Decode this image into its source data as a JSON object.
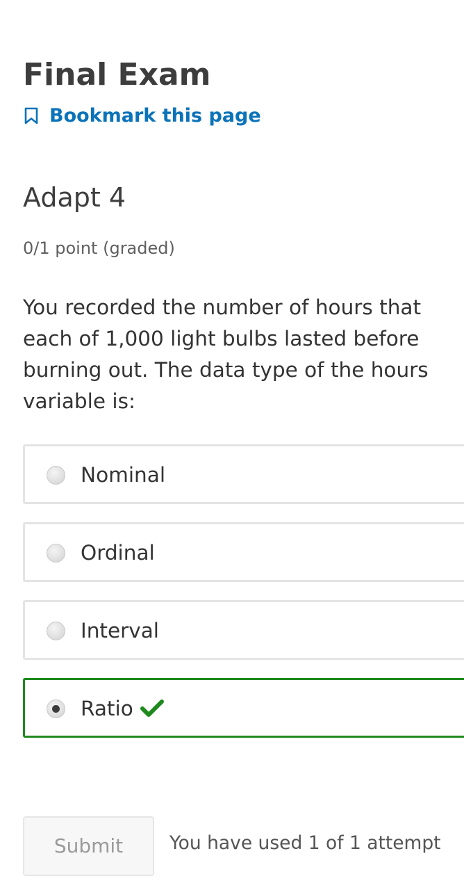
{
  "header": {
    "title": "Final Exam",
    "bookmark_label": "Bookmark this page"
  },
  "problem": {
    "title": "Adapt 4",
    "points": "0/1 point (graded)",
    "question": "You recorded the number of hours that each of 1,000 light bulbs lasted before burning out. The data type of the hours variable is:",
    "options": [
      {
        "label": "Nominal",
        "selected": false,
        "correct": false
      },
      {
        "label": "Ordinal",
        "selected": false,
        "correct": false
      },
      {
        "label": "Interval",
        "selected": false,
        "correct": false
      },
      {
        "label": "Ratio",
        "selected": true,
        "correct": true
      }
    ]
  },
  "actions": {
    "submit_label": "Submit",
    "attempts_text": "You have used 1 of 1 attempt"
  },
  "icons": {
    "bookmark": "bookmark-icon",
    "correct": "checkmark-icon"
  },
  "colors": {
    "link": "#0b73b9",
    "correct": "#1e8a1e",
    "title": "#3d3d3d"
  }
}
